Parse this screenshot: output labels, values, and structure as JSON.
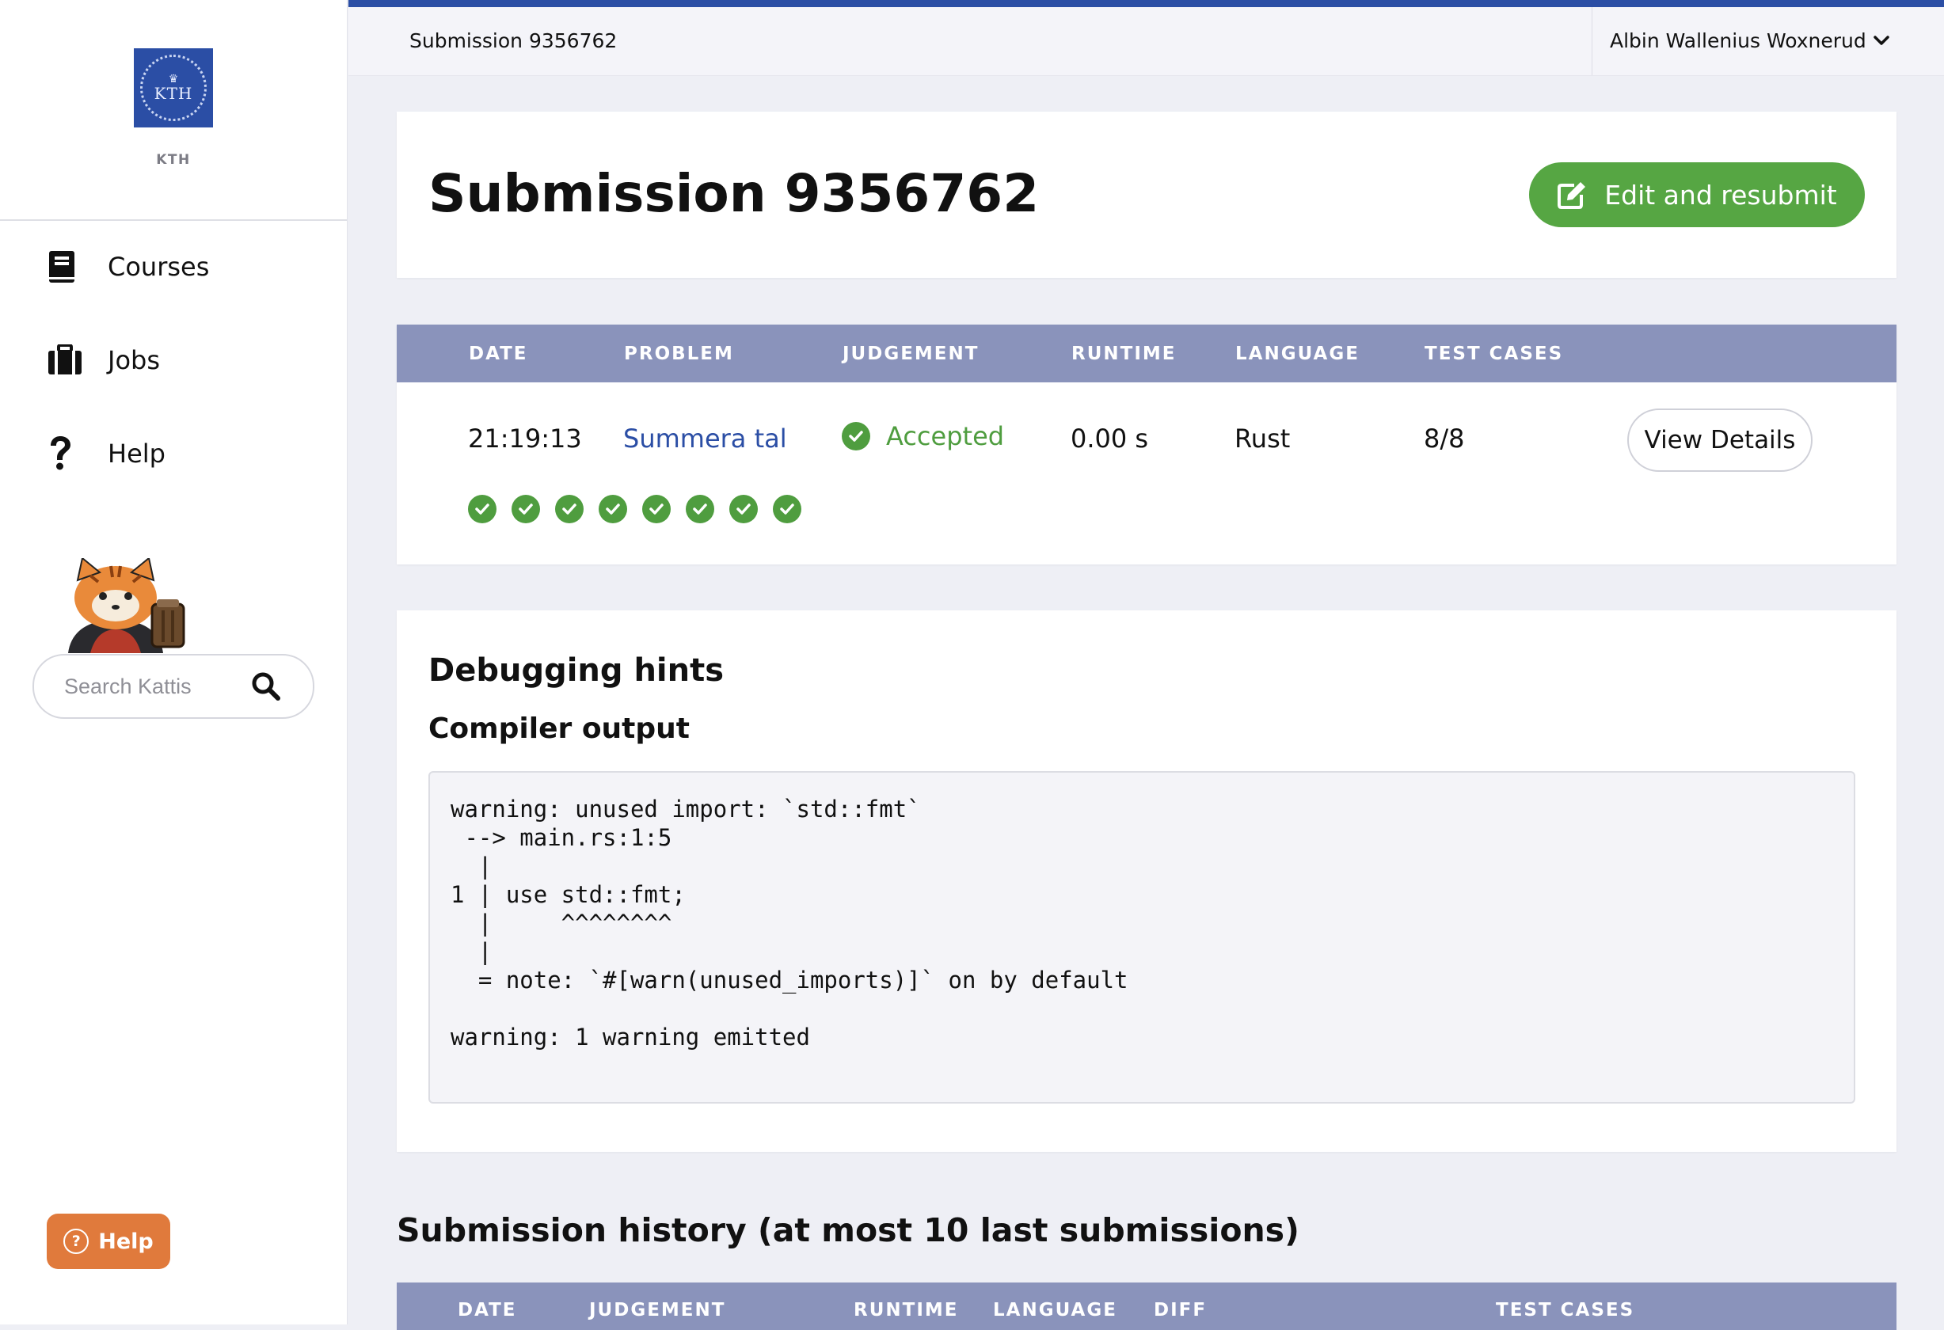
{
  "sidebar": {
    "logo_text": "KTH",
    "logo_caption": "KTH",
    "nav": [
      {
        "label": "Courses",
        "icon": "book-icon"
      },
      {
        "label": "Jobs",
        "icon": "briefcase-icon"
      },
      {
        "label": "Help",
        "icon": "question-icon"
      }
    ],
    "search_placeholder": "Search Kattis",
    "help_button": "Help"
  },
  "topbar": {
    "breadcrumb": "Submission 9356762",
    "user_name": "Albin Wallenius Woxnerud"
  },
  "header": {
    "title": "Submission 9356762",
    "resubmit_label": "Edit and resubmit"
  },
  "submission_table": {
    "columns": [
      "DATE",
      "PROBLEM",
      "JUDGEMENT",
      "RUNTIME",
      "LANGUAGE",
      "TEST CASES"
    ],
    "row": {
      "date": "21:19:13",
      "problem": "Summera tal",
      "judgement": "Accepted",
      "runtime": "0.00 s",
      "language": "Rust",
      "test_cases": "8/8"
    },
    "view_details_label": "View Details",
    "test_case_results": [
      "passed",
      "passed",
      "passed",
      "passed",
      "passed",
      "passed",
      "passed",
      "passed"
    ]
  },
  "debug": {
    "title": "Debugging hints",
    "subtitle": "Compiler output",
    "compiler_output": "warning: unused import: `std::fmt`\n --> main.rs:1:5\n  |\n1 | use std::fmt;\n  |     ^^^^^^^^\n  |\n  = note: `#[warn(unused_imports)]` on by default\n\nwarning: 1 warning emitted"
  },
  "history": {
    "title": "Submission history (at most 10 last submissions)",
    "columns": [
      "DATE",
      "JUDGEMENT",
      "RUNTIME",
      "LANGUAGE",
      "DIFF",
      "TEST CASES"
    ]
  },
  "colors": {
    "accent": "#2b4ea5",
    "success": "#56a643",
    "table_header": "#8a93bb",
    "help_button": "#e07a3c"
  }
}
